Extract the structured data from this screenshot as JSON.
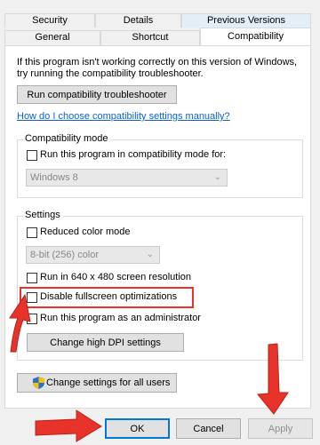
{
  "tabs": {
    "row1": [
      "Security",
      "Details",
      "Previous Versions"
    ],
    "row2": [
      "General",
      "Shortcut",
      "Compatibility"
    ],
    "active": "Compatibility"
  },
  "intro": {
    "line1": "If this program isn't working correctly on this version of Windows,",
    "line2": "try running the compatibility troubleshooter."
  },
  "troubleshooter_button": "Run compatibility troubleshooter",
  "help_link": "How do I choose compatibility settings manually?",
  "compat_mode": {
    "title": "Compatibility mode",
    "checkbox_label": "Run this program in compatibility mode for:",
    "checked": false,
    "select_value": "Windows 8"
  },
  "settings": {
    "title": "Settings",
    "reduced_color": {
      "label": "Reduced color mode",
      "checked": false
    },
    "color_select": "8-bit (256) color",
    "res640": {
      "label": "Run in 640 x 480 screen resolution",
      "checked": false
    },
    "fullscreen": {
      "label": "Disable fullscreen optimizations",
      "checked": false
    },
    "admin": {
      "label": "Run this program as an administrator",
      "checked": false
    },
    "dpi_button": "Change high DPI settings"
  },
  "all_users_button": "Change settings for all users",
  "footer": {
    "ok": "OK",
    "cancel": "Cancel",
    "apply": "Apply"
  },
  "colors": {
    "annotation_red": "#e8332b",
    "link_blue": "#0b63ce",
    "focus_blue": "#0078d7"
  }
}
